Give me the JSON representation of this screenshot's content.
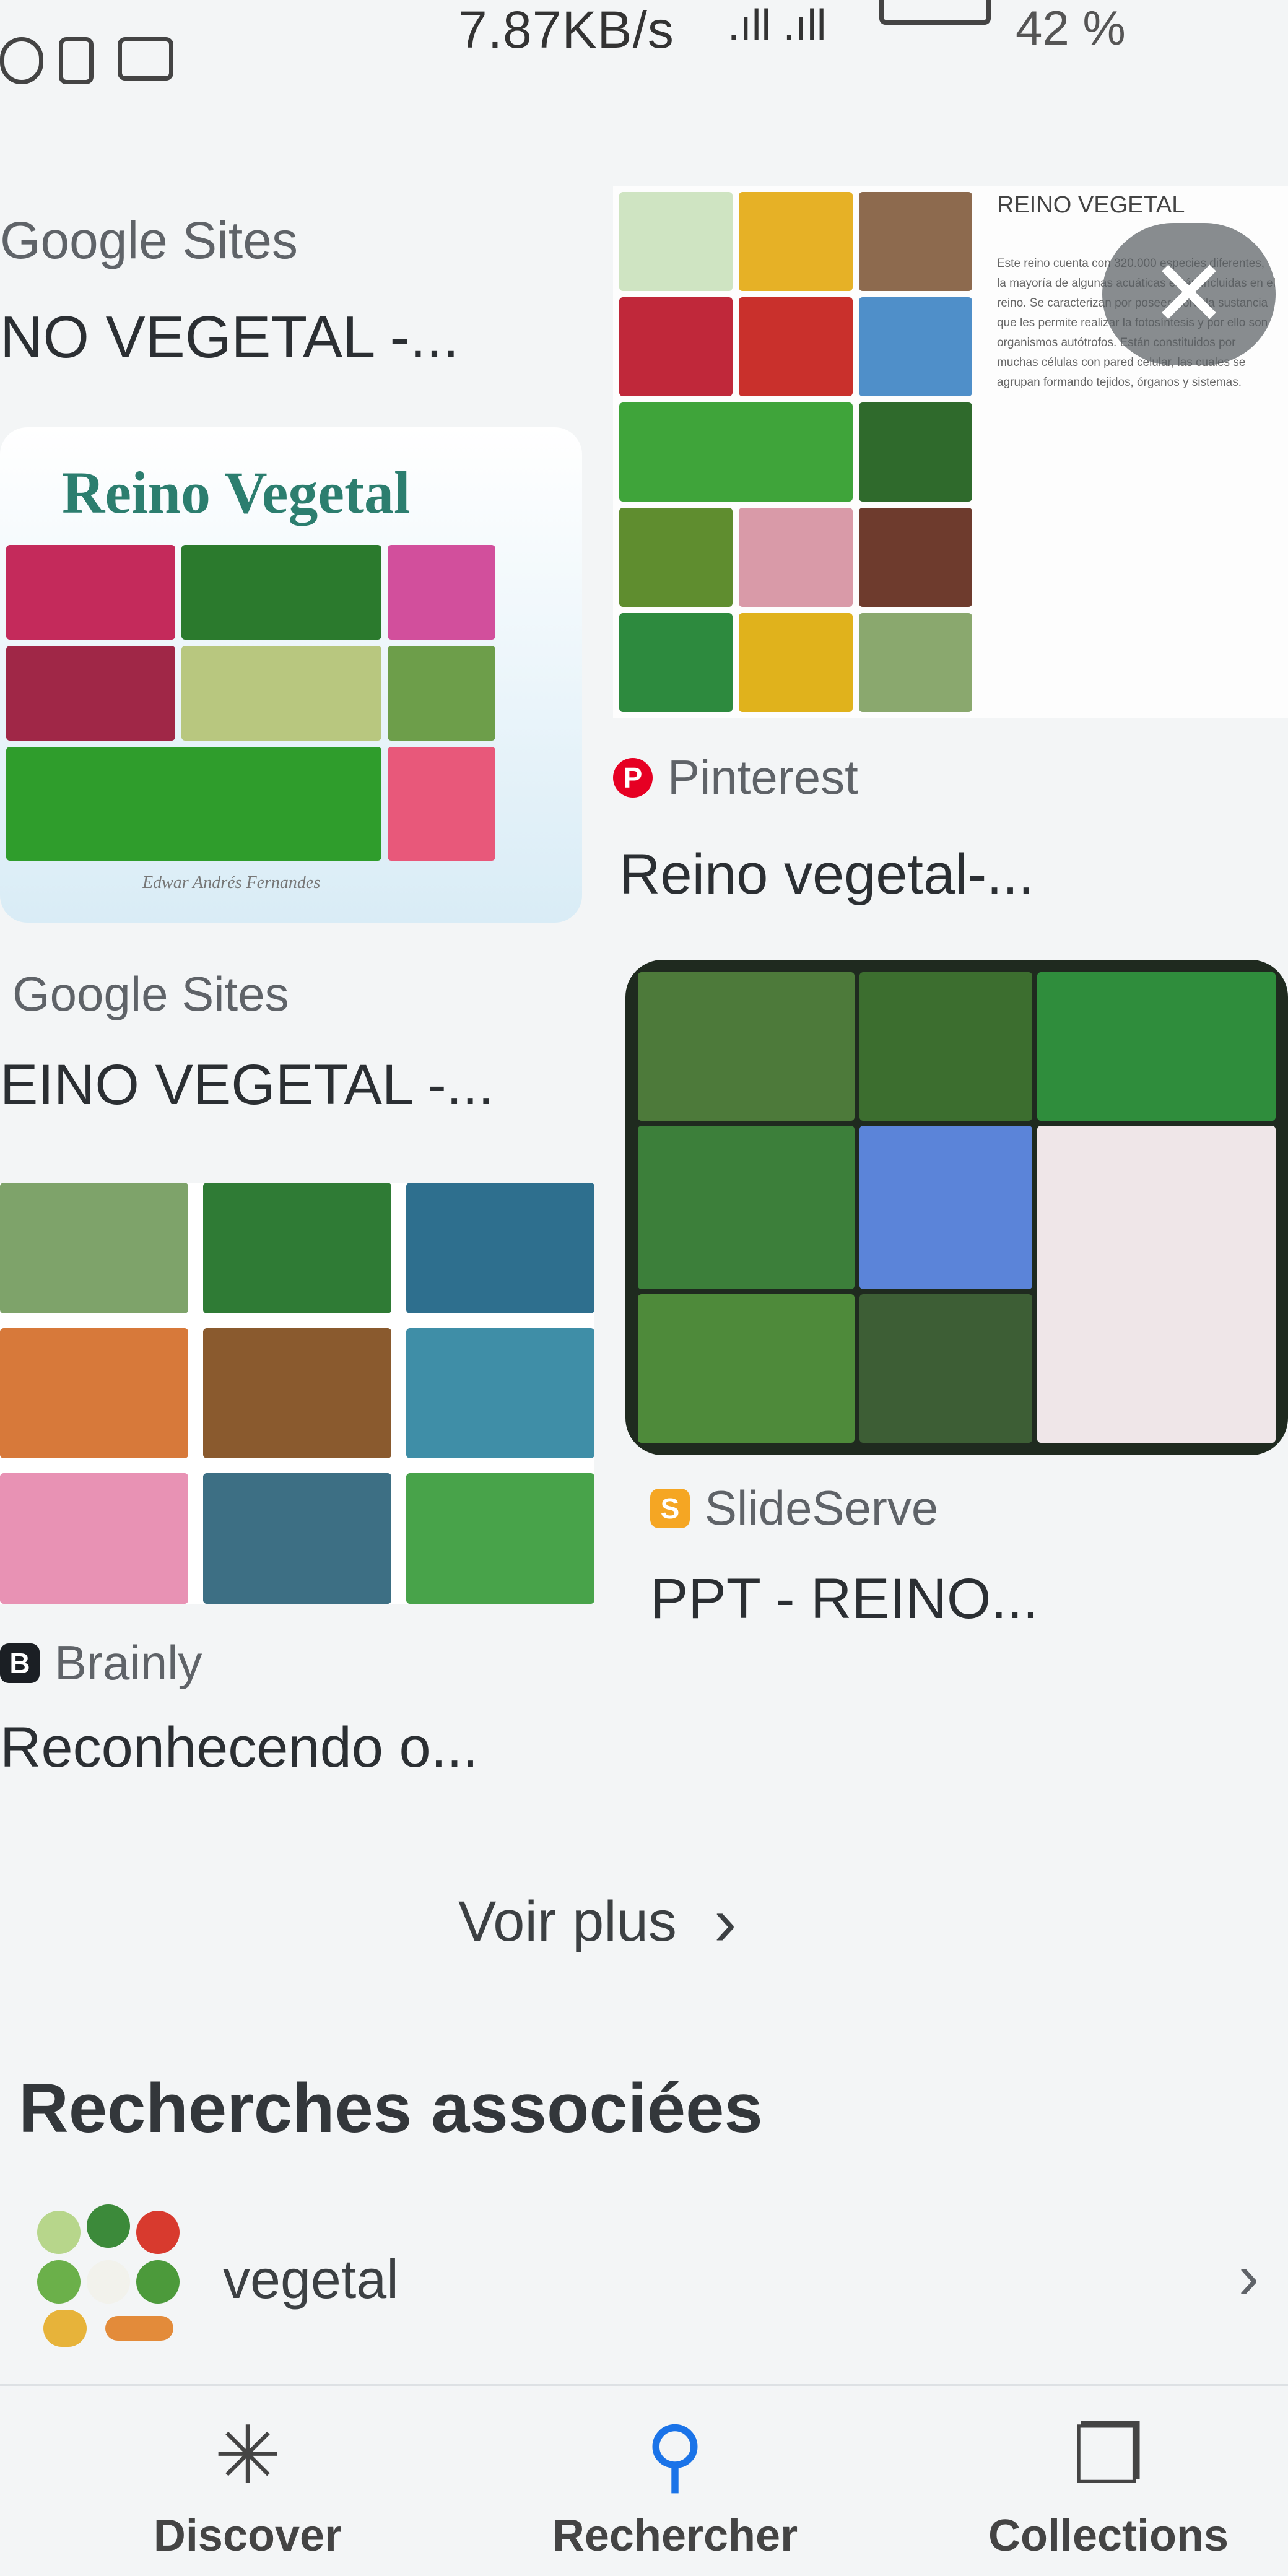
{
  "status_bar": {
    "speed": "7.87KB/s",
    "signal": ".ıll .ıll",
    "battery_pct": "42 %"
  },
  "results": [
    {
      "source": "Google Sites",
      "title": "NO VEGETAL -...",
      "thumb_title": "",
      "source_color": "#ffffff"
    },
    {
      "source": "Pinterest",
      "title": "Reino vegetal-...",
      "thumb_title": "REINO VEGETAL",
      "thumb_text": "Este reino cuenta con 320.000 especies diferentes, la mayoría de algunas acuáticas están incluidas en el reino. Se caracterizan por poseer clorofila sustancia que les permite realizar la fotosíntesis y por ello son organismos autótrofos. Están constituidos por muchas células con pared celular, las cuales se agrupan formando tejidos, órganos y sistemas.",
      "source_color": "#e60023"
    },
    {
      "source": "Google Sites",
      "title": "EINO VEGETAL -...",
      "thumb_title": "Reino Vegetal",
      "thumb_caption": "Edwar Andrés Fernandes"
    },
    {
      "source": "SlideServe",
      "title": "PPT - REINO...",
      "source_color": "#f5a623"
    },
    {
      "source": "Brainly",
      "title": "Reconhecendo o...",
      "source_color": "#1b1f24"
    }
  ],
  "close_button": "✕",
  "see_more": {
    "label": "Voir plus",
    "chevron": "›"
  },
  "associated": {
    "heading": "Recherches associées",
    "items": [
      {
        "label": "vegetal",
        "chevron": "›"
      }
    ]
  },
  "bottom_nav": [
    {
      "label": "Discover",
      "icon": "asterisk-icon",
      "glyph": "✳",
      "active": false
    },
    {
      "label": "Rechercher",
      "icon": "search-icon",
      "glyph": "⚲",
      "active": true
    },
    {
      "label": "Collections",
      "icon": "collections-icon",
      "glyph": "❐",
      "active": false
    }
  ],
  "colors": {
    "accent": "#1a73e8",
    "background": "#f3f5f6"
  }
}
